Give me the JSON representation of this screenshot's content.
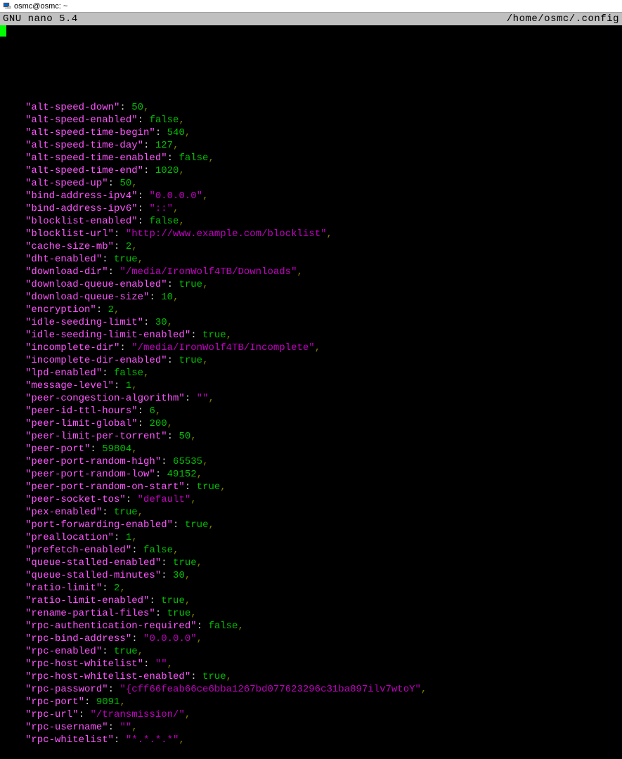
{
  "window": {
    "title": "osmc@osmc: ~"
  },
  "editor": {
    "name": "GNU nano 5.4",
    "filepath": "/home/osmc/.config"
  },
  "entries": [
    {
      "key": "alt-speed-down",
      "value": "50",
      "type": "n"
    },
    {
      "key": "alt-speed-enabled",
      "value": "false",
      "type": "b"
    },
    {
      "key": "alt-speed-time-begin",
      "value": "540",
      "type": "n"
    },
    {
      "key": "alt-speed-time-day",
      "value": "127",
      "type": "n"
    },
    {
      "key": "alt-speed-time-enabled",
      "value": "false",
      "type": "b"
    },
    {
      "key": "alt-speed-time-end",
      "value": "1020",
      "type": "n"
    },
    {
      "key": "alt-speed-up",
      "value": "50",
      "type": "n"
    },
    {
      "key": "bind-address-ipv4",
      "value": "\"0.0.0.0\"",
      "type": "s"
    },
    {
      "key": "bind-address-ipv6",
      "value": "\"::\"",
      "type": "s"
    },
    {
      "key": "blocklist-enabled",
      "value": "false",
      "type": "b"
    },
    {
      "key": "blocklist-url",
      "value": "\"http://www.example.com/blocklist\"",
      "type": "s"
    },
    {
      "key": "cache-size-mb",
      "value": "2",
      "type": "n"
    },
    {
      "key": "dht-enabled",
      "value": "true",
      "type": "b"
    },
    {
      "key": "download-dir",
      "value": "\"/media/IronWolf4TB/Downloads\"",
      "type": "s"
    },
    {
      "key": "download-queue-enabled",
      "value": "true",
      "type": "b"
    },
    {
      "key": "download-queue-size",
      "value": "10",
      "type": "n"
    },
    {
      "key": "encryption",
      "value": "2",
      "type": "n"
    },
    {
      "key": "idle-seeding-limit",
      "value": "30",
      "type": "n"
    },
    {
      "key": "idle-seeding-limit-enabled",
      "value": "true",
      "type": "b"
    },
    {
      "key": "incomplete-dir",
      "value": "\"/media/IronWolf4TB/Incomplete\"",
      "type": "s"
    },
    {
      "key": "incomplete-dir-enabled",
      "value": "true",
      "type": "b"
    },
    {
      "key": "lpd-enabled",
      "value": "false",
      "type": "b"
    },
    {
      "key": "message-level",
      "value": "1",
      "type": "n"
    },
    {
      "key": "peer-congestion-algorithm",
      "value": "\"\"",
      "type": "s"
    },
    {
      "key": "peer-id-ttl-hours",
      "value": "6",
      "type": "n"
    },
    {
      "key": "peer-limit-global",
      "value": "200",
      "type": "n"
    },
    {
      "key": "peer-limit-per-torrent",
      "value": "50",
      "type": "n"
    },
    {
      "key": "peer-port",
      "value": "59804",
      "type": "n"
    },
    {
      "key": "peer-port-random-high",
      "value": "65535",
      "type": "n"
    },
    {
      "key": "peer-port-random-low",
      "value": "49152",
      "type": "n"
    },
    {
      "key": "peer-port-random-on-start",
      "value": "true",
      "type": "b"
    },
    {
      "key": "peer-socket-tos",
      "value": "\"default\"",
      "type": "s"
    },
    {
      "key": "pex-enabled",
      "value": "true",
      "type": "b"
    },
    {
      "key": "port-forwarding-enabled",
      "value": "true",
      "type": "b"
    },
    {
      "key": "preallocation",
      "value": "1",
      "type": "n"
    },
    {
      "key": "prefetch-enabled",
      "value": "false",
      "type": "b"
    },
    {
      "key": "queue-stalled-enabled",
      "value": "true",
      "type": "b"
    },
    {
      "key": "queue-stalled-minutes",
      "value": "30",
      "type": "n"
    },
    {
      "key": "ratio-limit",
      "value": "2",
      "type": "n"
    },
    {
      "key": "ratio-limit-enabled",
      "value": "true",
      "type": "b"
    },
    {
      "key": "rename-partial-files",
      "value": "true",
      "type": "b"
    },
    {
      "key": "rpc-authentication-required",
      "value": "false",
      "type": "b"
    },
    {
      "key": "rpc-bind-address",
      "value": "\"0.0.0.0\"",
      "type": "s"
    },
    {
      "key": "rpc-enabled",
      "value": "true",
      "type": "b"
    },
    {
      "key": "rpc-host-whitelist",
      "value": "\"\"",
      "type": "s"
    },
    {
      "key": "rpc-host-whitelist-enabled",
      "value": "true",
      "type": "b"
    },
    {
      "key": "rpc-password",
      "value": "\"{cff66feab66ce6bba1267bd077623296c31ba897ilv7wtoY\"",
      "type": "s"
    },
    {
      "key": "rpc-port",
      "value": "9091",
      "type": "n"
    },
    {
      "key": "rpc-url",
      "value": "\"/transmission/\"",
      "type": "s"
    },
    {
      "key": "rpc-username",
      "value": "\"\"",
      "type": "s"
    },
    {
      "key": "rpc-whitelist",
      "value": "\"*.*.*.*\"",
      "type": "s"
    }
  ]
}
